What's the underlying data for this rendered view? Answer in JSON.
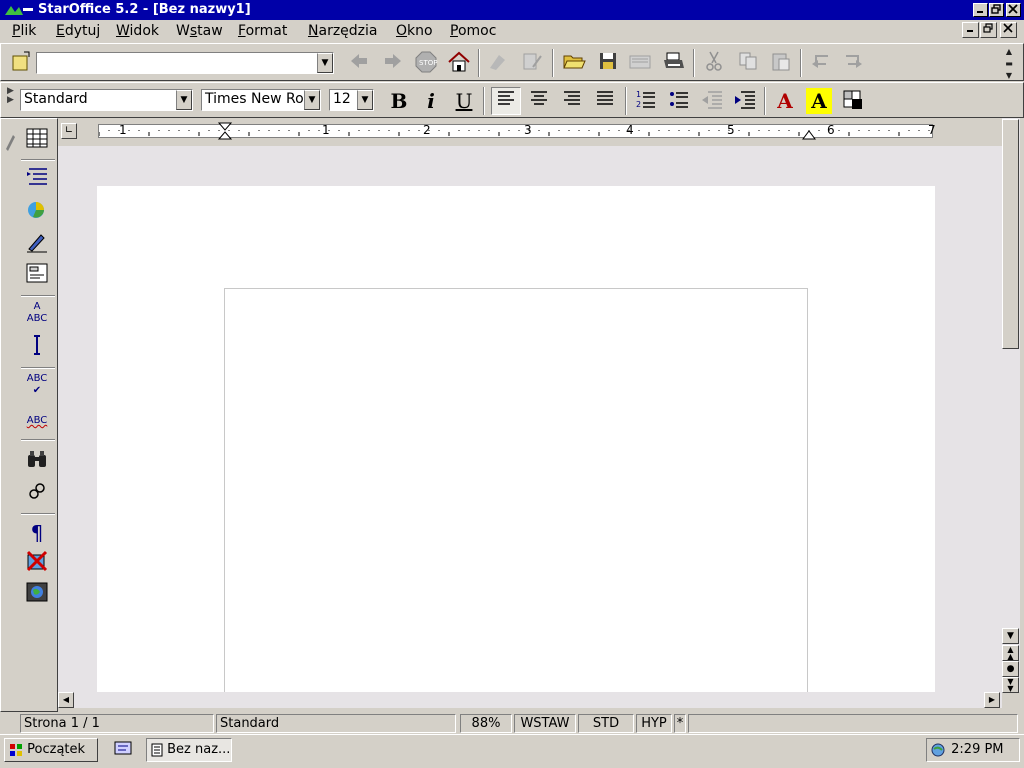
{
  "window": {
    "title": "StarOffice 5.2 - [Bez nazwy1]"
  },
  "menu": [
    "Plik",
    "Edytuj",
    "Widok",
    "Wstaw",
    "Format",
    "Narzędzia",
    "Okno",
    "Pomoc"
  ],
  "menu_underline": [
    "P",
    "E",
    "W",
    "s",
    "F",
    "N",
    "O",
    "P"
  ],
  "toolbar": {
    "url_value": ""
  },
  "format": {
    "style": "Standard",
    "font": "Times New Ror",
    "size": "12",
    "bold_label": "B",
    "italic_label": "i",
    "underline_label": "U"
  },
  "ruler": {
    "numbers": [
      "1",
      "1",
      "2",
      "3",
      "4",
      "5",
      "6",
      "7"
    ]
  },
  "status": {
    "page": "Strona  1 / 1",
    "style": "Standard",
    "zoom": "88%",
    "insert_mode": "WSTAW",
    "selection_mode": "STD",
    "hyperlink_mode": "HYP",
    "modified": "*"
  },
  "taskbar": {
    "start_label": "Początek",
    "window_label": "Bez naz...",
    "clock": "2:29 PM"
  },
  "icons": {
    "new": "new-document-icon",
    "back": "back-arrow-icon",
    "forward": "forward-arrow-icon",
    "stop": "stop-icon",
    "home": "home-icon",
    "open": "open-folder-icon",
    "save": "save-icon",
    "print": "print-icon",
    "cut": "cut-icon",
    "copy": "copy-icon",
    "paste": "paste-icon",
    "undo": "undo-icon",
    "redo": "redo-icon"
  },
  "colors": {
    "title_bar": "#0000a8",
    "workspace": "#e6e3e6",
    "font_color": "#b00000",
    "highlight": "#ffff00"
  }
}
